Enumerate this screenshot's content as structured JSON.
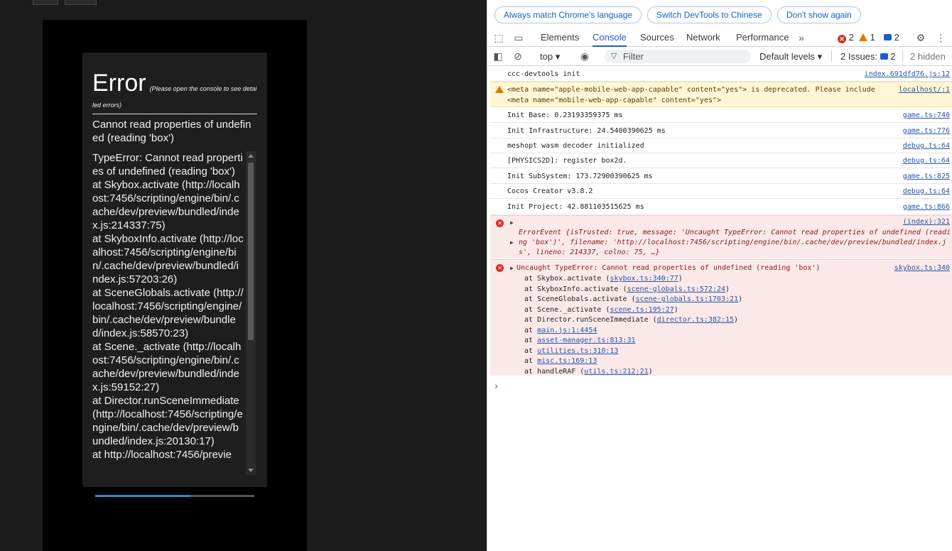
{
  "game": {
    "error_title": "Error",
    "error_hint": "(Please open the console to see detailed errors)",
    "error_message": "Cannot read properties of undefined (reading 'box')",
    "stack_lines": [
      "TypeError: Cannot read properties of undefined (reading 'box')",
      "at Skybox.activate (http://localhost:7456/scripting/engine/bin/.cache/dev/preview/bundled/index.js:214337:75)",
      "at SkyboxInfo.activate (http://localhost:7456/scripting/engine/bin/.cache/dev/preview/bundled/index.js:57203:26)",
      "at SceneGlobals.activate (http://localhost:7456/scripting/engine/bin/.cache/dev/preview/bundled/index.js:58570:23)",
      "at Scene._activate (http://localhost:7456/scripting/engine/bin/.cache/dev/preview/bundled/index.js:59152:27)",
      "at Director.runSceneImmediate (http://localhost:7456/scripting/engine/bin/.cache/dev/preview/bundled/index.js:20130:17)",
      "at http://localhost:7456/previe"
    ],
    "progress_fraction": 0.6
  },
  "devtools": {
    "infobar": {
      "match_language": "Always match Chrome's language",
      "switch_chinese": "Switch DevTools to Chinese",
      "dont_show": "Don't show again"
    },
    "tabs": [
      "Elements",
      "Console",
      "Sources",
      "Network",
      "Performance"
    ],
    "active_tab": "Console",
    "counts": {
      "errors": "2",
      "warnings": "1",
      "messages": "2"
    },
    "toolbar": {
      "context": "top",
      "filter_placeholder": "Filter",
      "levels": "Default levels",
      "issues_label": "2 Issues:",
      "issues_count": "2",
      "hidden": "2 hidden"
    },
    "logs": [
      {
        "text": "ccc-devtools init",
        "src": "index.691dfd76.js:12"
      },
      {
        "text": "Init Base: 0.23193359375 ms",
        "src": "game.ts:740"
      },
      {
        "text": "Init Infrastructure: 24.5400390625 ms",
        "src": "game.ts:776"
      },
      {
        "text": "meshopt wasm decoder initialized",
        "src": "debug.ts:64"
      },
      {
        "text": "[PHYSICS2D]: register box2d.",
        "src": "debug.ts:64"
      },
      {
        "text": "Init SubSystem: 173.72900390625 ms",
        "src": "game.ts:825"
      },
      {
        "text": "Cocos Creator v3.8.2",
        "src": "debug.ts:64"
      },
      {
        "text": "Init Project: 42.881103515625 ms",
        "src": "game.ts:866"
      }
    ],
    "warning": {
      "line1": "<meta name=\"apple-mobile-web-app-capable\" content=\"yes\"> is deprecated. Please include",
      "line2": "<meta name=\"mobile-web-app-capable\" content=\"yes\">",
      "src": "localhost/:1"
    },
    "error_event": {
      "src": "(index):321",
      "line1": "ErrorEvent {isTrusted: true, message: 'Uncaught TypeError: Cannot read properties of undefined (readi",
      "line2": "ng 'box')', filename: 'http://localhost:7456/scripting/engine/bin/.cache/dev/preview/bundled/index.j",
      "line3": "s', lineno: 214337, colno: 75, …}"
    },
    "uncaught": {
      "text": "Uncaught TypeError: Cannot read properties of undefined (reading 'box')",
      "src": "skybox.ts:340",
      "frames": [
        {
          "fn": "at Skybox.activate (",
          "link": "skybox.ts:340:77",
          "end": ")"
        },
        {
          "fn": "at SkyboxInfo.activate (",
          "link": "scene-globals.ts:572:24",
          "end": ")"
        },
        {
          "fn": "at SceneGlobals.activate (",
          "link": "scene-globals.ts:1703:21",
          "end": ")"
        },
        {
          "fn": "at Scene._activate (",
          "link": "scene.ts:195:27",
          "end": ")"
        },
        {
          "fn": "at Director.runSceneImmediate (",
          "link": "director.ts:382:15",
          "end": ")"
        },
        {
          "fn": "at ",
          "link": "main.js:1:4454",
          "end": ""
        },
        {
          "fn": "at ",
          "link": "asset-manager.ts:813:31",
          "end": ""
        },
        {
          "fn": "at ",
          "link": "utilities.ts:310:13",
          "end": ""
        },
        {
          "fn": "at ",
          "link": "misc.ts:169:13",
          "end": ""
        },
        {
          "fn": "at handleRAF (",
          "link": "utils.ts:212:21",
          "end": ")"
        }
      ]
    }
  }
}
